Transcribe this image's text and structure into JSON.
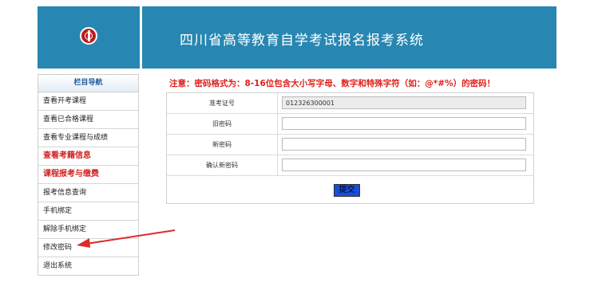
{
  "header": {
    "title": "四川省高等教育自学考试报名报考系统",
    "logo_icon": "university-seal-icon"
  },
  "sidebar": {
    "title": "栏目导航",
    "items": [
      {
        "label": "查看开考课程"
      },
      {
        "label": "查看已合格课程"
      },
      {
        "label": "查看专业课程与成绩"
      },
      {
        "label": "查看考籍信息"
      },
      {
        "label": "课程报考与缴费"
      },
      {
        "label": "报考信息查询"
      },
      {
        "label": "手机绑定"
      },
      {
        "label": "解除手机绑定"
      },
      {
        "label": "修改密码"
      },
      {
        "label": "退出系统"
      }
    ]
  },
  "notice": "注意：密码格式为：8-16位包含大小写字母、数字和特殊字符（如：@*#%）的密码！",
  "form": {
    "exam_id_label": "准考证号",
    "exam_id_value": "012326300001",
    "old_password_label": "旧密码",
    "new_password_label": "新密码",
    "confirm_password_label": "确认新密码",
    "submit_label": "提交"
  },
  "colors": {
    "banner": "#2787b2",
    "notice_red": "#e0201a",
    "nav_red": "#d41f1f",
    "submit_blue": "#1a4dd8",
    "arrow": "#e02a2a"
  }
}
